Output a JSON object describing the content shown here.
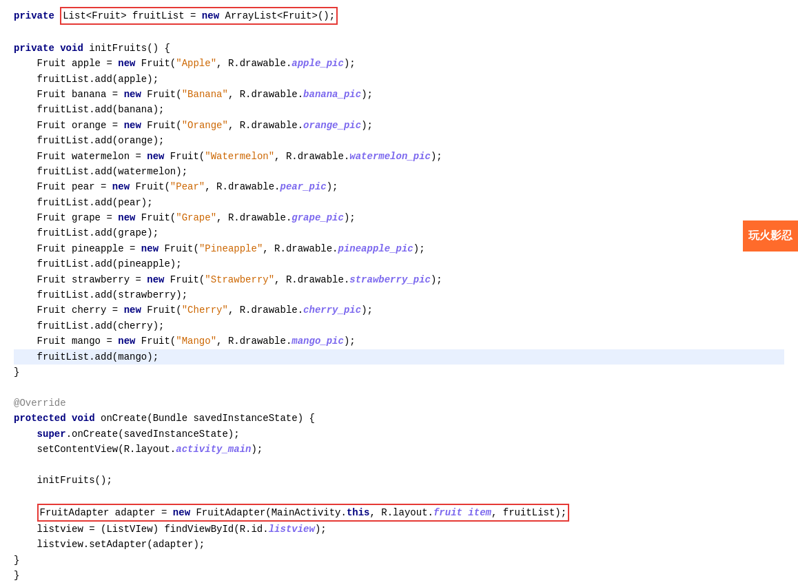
{
  "ad": {
    "label": "玩火影忍"
  },
  "code": {
    "lines": [
      {
        "id": 1,
        "tokens": [
          {
            "text": "private ",
            "class": "kw"
          },
          {
            "text": "List<Fruit> fruitList = ",
            "class": ""
          },
          {
            "text": "new",
            "class": "kw"
          },
          {
            "text": " ArrayList<Fruit>();",
            "class": ""
          }
        ],
        "boxed": true
      },
      {
        "id": 2,
        "tokens": [
          {
            "text": "",
            "class": ""
          }
        ]
      },
      {
        "id": 3,
        "tokens": [
          {
            "text": "private ",
            "class": "kw"
          },
          {
            "text": "void",
            "class": "kw"
          },
          {
            "text": " initFruits() {",
            "class": ""
          }
        ]
      },
      {
        "id": 4,
        "tokens": [
          {
            "text": "    Fruit apple = ",
            "class": ""
          },
          {
            "text": "new",
            "class": "kw"
          },
          {
            "text": " Fruit(",
            "class": ""
          },
          {
            "text": "\"Apple\"",
            "class": "str"
          },
          {
            "text": ", R.drawable.",
            "class": ""
          },
          {
            "text": "apple_pic",
            "class": "field-italic"
          },
          {
            "text": ");",
            "class": ""
          }
        ]
      },
      {
        "id": 5,
        "tokens": [
          {
            "text": "    fruitList.add(apple);",
            "class": ""
          }
        ]
      },
      {
        "id": 6,
        "tokens": [
          {
            "text": "    Fruit banana = ",
            "class": ""
          },
          {
            "text": "new",
            "class": "kw"
          },
          {
            "text": " Fruit(",
            "class": ""
          },
          {
            "text": "\"Banana\"",
            "class": "str"
          },
          {
            "text": ", R.drawable.",
            "class": ""
          },
          {
            "text": "banana_pic",
            "class": "field-italic"
          },
          {
            "text": ");",
            "class": ""
          }
        ]
      },
      {
        "id": 7,
        "tokens": [
          {
            "text": "    fruitList.add(banana);",
            "class": ""
          }
        ]
      },
      {
        "id": 8,
        "tokens": [
          {
            "text": "    Fruit orange = ",
            "class": ""
          },
          {
            "text": "new",
            "class": "kw"
          },
          {
            "text": " Fruit(",
            "class": ""
          },
          {
            "text": "\"Orange\"",
            "class": "str"
          },
          {
            "text": ", R.drawable.",
            "class": ""
          },
          {
            "text": "orange_pic",
            "class": "field-italic"
          },
          {
            "text": ");",
            "class": ""
          }
        ]
      },
      {
        "id": 9,
        "tokens": [
          {
            "text": "    fruitList.add(orange);",
            "class": ""
          }
        ]
      },
      {
        "id": 10,
        "tokens": [
          {
            "text": "    Fruit watermelon = ",
            "class": ""
          },
          {
            "text": "new",
            "class": "kw"
          },
          {
            "text": " Fruit(",
            "class": ""
          },
          {
            "text": "\"Watermelon\"",
            "class": "str"
          },
          {
            "text": ", R.drawable.",
            "class": ""
          },
          {
            "text": "watermelon_pic",
            "class": "field-italic"
          },
          {
            "text": ");",
            "class": ""
          }
        ]
      },
      {
        "id": 11,
        "tokens": [
          {
            "text": "    fruitList.add(watermelon);",
            "class": ""
          }
        ]
      },
      {
        "id": 12,
        "tokens": [
          {
            "text": "    Fruit pear = ",
            "class": ""
          },
          {
            "text": "new",
            "class": "kw"
          },
          {
            "text": " Fruit(",
            "class": ""
          },
          {
            "text": "\"Pear\"",
            "class": "str"
          },
          {
            "text": ", R.drawable.",
            "class": ""
          },
          {
            "text": "pear_pic",
            "class": "field-italic"
          },
          {
            "text": ");",
            "class": ""
          }
        ]
      },
      {
        "id": 13,
        "tokens": [
          {
            "text": "    fruitList.add(pear);",
            "class": ""
          }
        ]
      },
      {
        "id": 14,
        "tokens": [
          {
            "text": "    Fruit grape = ",
            "class": ""
          },
          {
            "text": "new",
            "class": "kw"
          },
          {
            "text": " Fruit(",
            "class": ""
          },
          {
            "text": "\"Grape\"",
            "class": "str"
          },
          {
            "text": ", R.drawable.",
            "class": ""
          },
          {
            "text": "grape_pic",
            "class": "field-italic"
          },
          {
            "text": ");",
            "class": ""
          }
        ]
      },
      {
        "id": 15,
        "tokens": [
          {
            "text": "    fruitList.add(grape);",
            "class": ""
          }
        ]
      },
      {
        "id": 16,
        "tokens": [
          {
            "text": "    Fruit pineapple = ",
            "class": ""
          },
          {
            "text": "new",
            "class": "kw"
          },
          {
            "text": " Fruit(",
            "class": ""
          },
          {
            "text": "\"Pineapple\"",
            "class": "str"
          },
          {
            "text": ", R.drawable.",
            "class": ""
          },
          {
            "text": "pineapple_pic",
            "class": "field-italic"
          },
          {
            "text": ");",
            "class": ""
          }
        ]
      },
      {
        "id": 17,
        "tokens": [
          {
            "text": "    fruitList.add(pineapple);",
            "class": ""
          }
        ]
      },
      {
        "id": 18,
        "tokens": [
          {
            "text": "    Fruit strawberry = ",
            "class": ""
          },
          {
            "text": "new",
            "class": "kw"
          },
          {
            "text": " Fruit(",
            "class": ""
          },
          {
            "text": "\"Strawberry\"",
            "class": "str"
          },
          {
            "text": ", R.drawable.",
            "class": ""
          },
          {
            "text": "strawberry_pic",
            "class": "field-italic"
          },
          {
            "text": ");",
            "class": ""
          }
        ]
      },
      {
        "id": 19,
        "tokens": [
          {
            "text": "    fruitList.add(strawberry);",
            "class": ""
          }
        ]
      },
      {
        "id": 20,
        "tokens": [
          {
            "text": "    Fruit cherry = ",
            "class": ""
          },
          {
            "text": "new",
            "class": "kw"
          },
          {
            "text": " Fruit(",
            "class": ""
          },
          {
            "text": "\"Cherry\"",
            "class": "str"
          },
          {
            "text": ", R.drawable.",
            "class": ""
          },
          {
            "text": "cherry_pic",
            "class": "field-italic"
          },
          {
            "text": ");",
            "class": ""
          }
        ]
      },
      {
        "id": 21,
        "tokens": [
          {
            "text": "    fruitList.add(cherry);",
            "class": ""
          }
        ]
      },
      {
        "id": 22,
        "tokens": [
          {
            "text": "    Fruit mango = ",
            "class": ""
          },
          {
            "text": "new",
            "class": "kw"
          },
          {
            "text": " Fruit(",
            "class": ""
          },
          {
            "text": "\"Mango\"",
            "class": "str"
          },
          {
            "text": ", R.drawable.",
            "class": ""
          },
          {
            "text": "mango_pic",
            "class": "field-italic"
          },
          {
            "text": ");",
            "class": ""
          }
        ]
      },
      {
        "id": 23,
        "tokens": [
          {
            "text": "    fruitList.add(mango);",
            "class": ""
          }
        ],
        "highlighted": true
      },
      {
        "id": 24,
        "tokens": [
          {
            "text": "}",
            "class": ""
          }
        ]
      },
      {
        "id": 25,
        "tokens": [
          {
            "text": "",
            "class": ""
          }
        ]
      },
      {
        "id": 26,
        "tokens": [
          {
            "text": "@Override",
            "class": "annotation"
          }
        ]
      },
      {
        "id": 27,
        "tokens": [
          {
            "text": "protected ",
            "class": "kw"
          },
          {
            "text": "void",
            "class": "kw"
          },
          {
            "text": " onCreate(Bundle savedInstanceState) {",
            "class": ""
          }
        ]
      },
      {
        "id": 28,
        "tokens": [
          {
            "text": "    super",
            "class": "kw"
          },
          {
            "text": ".onCreate(savedInstanceState);",
            "class": ""
          }
        ]
      },
      {
        "id": 29,
        "tokens": [
          {
            "text": "    setContentView(R.layout.",
            "class": ""
          },
          {
            "text": "activity_main",
            "class": "field-italic"
          },
          {
            "text": ");",
            "class": ""
          }
        ]
      },
      {
        "id": 30,
        "tokens": [
          {
            "text": "",
            "class": ""
          }
        ]
      },
      {
        "id": 31,
        "tokens": [
          {
            "text": "    initFruits();",
            "class": ""
          }
        ]
      },
      {
        "id": 32,
        "tokens": [
          {
            "text": "",
            "class": ""
          }
        ]
      },
      {
        "id": 33,
        "tokens": [
          {
            "text": "    FruitAdapter adapter = ",
            "class": ""
          },
          {
            "text": "new",
            "class": "kw"
          },
          {
            "text": " FruitAdapter(MainActivity.",
            "class": ""
          },
          {
            "text": "this",
            "class": "kw"
          },
          {
            "text": ", R.layout.",
            "class": ""
          },
          {
            "text": "fruit item",
            "class": "field-italic"
          },
          {
            "text": ", fruitList);",
            "class": ""
          }
        ],
        "boxed": true
      },
      {
        "id": 34,
        "tokens": [
          {
            "text": "    listview = (ListVIew) findViewById(R.id.",
            "class": ""
          },
          {
            "text": "listview",
            "class": "field-italic"
          },
          {
            "text": ");",
            "class": ""
          }
        ]
      },
      {
        "id": 35,
        "tokens": [
          {
            "text": "    listview.setAdapter(adapter);",
            "class": ""
          }
        ]
      },
      {
        "id": 36,
        "tokens": [
          {
            "text": "}",
            "class": ""
          }
        ]
      },
      {
        "id": 37,
        "tokens": [
          {
            "text": "}",
            "class": ""
          }
        ]
      }
    ]
  }
}
